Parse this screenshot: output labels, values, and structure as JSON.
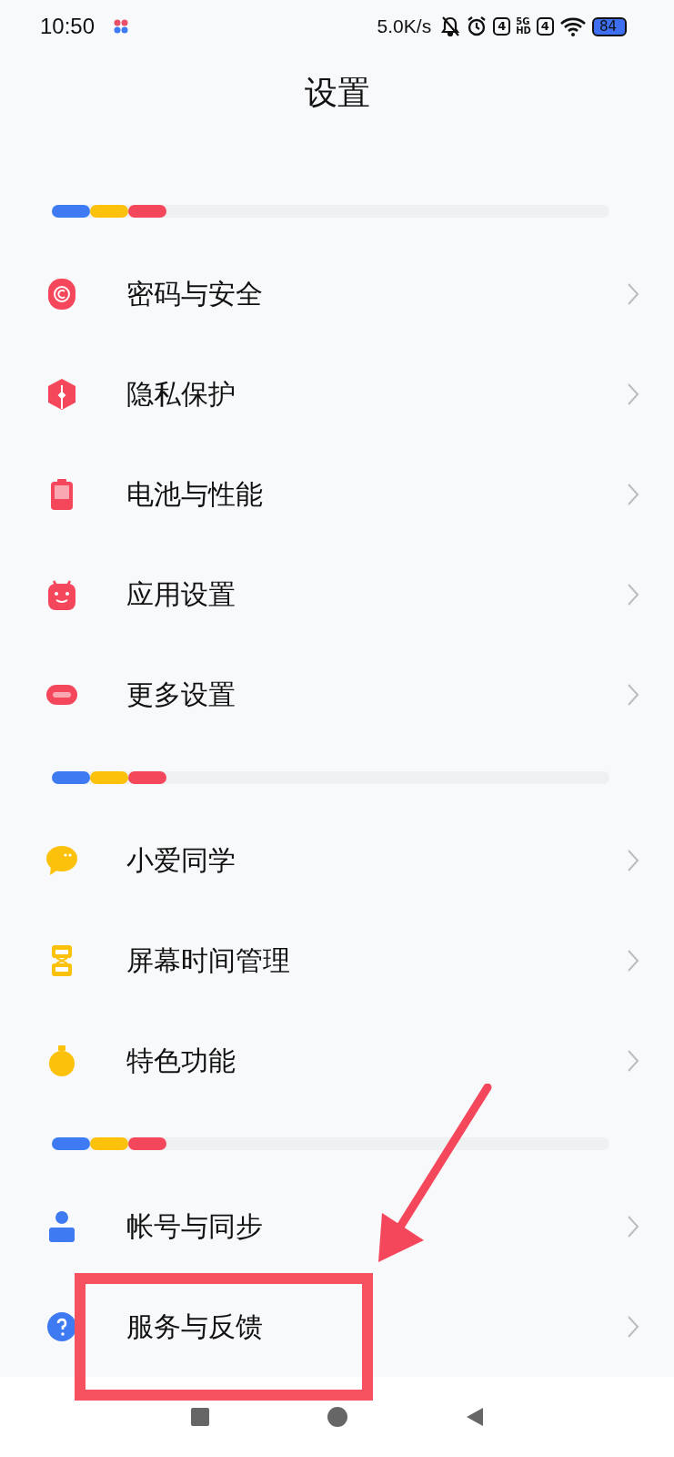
{
  "status_bar": {
    "time": "10:50",
    "net_speed": "5.0K/s",
    "sim_labels": [
      "4",
      "4"
    ],
    "network_top": "5G",
    "network_bottom": "HD",
    "battery": "84"
  },
  "header": {
    "title": "设置"
  },
  "groups": [
    {
      "items": [
        {
          "label": "密码与安全"
        },
        {
          "label": "隐私保护"
        },
        {
          "label": "电池与性能"
        },
        {
          "label": "应用设置"
        },
        {
          "label": "更多设置"
        }
      ]
    },
    {
      "items": [
        {
          "label": "小爱同学"
        },
        {
          "label": "屏幕时间管理"
        },
        {
          "label": "特色功能"
        }
      ]
    },
    {
      "items": [
        {
          "label": "帐号与同步"
        },
        {
          "label": "服务与反馈",
          "highlighted": true
        }
      ]
    }
  ]
}
